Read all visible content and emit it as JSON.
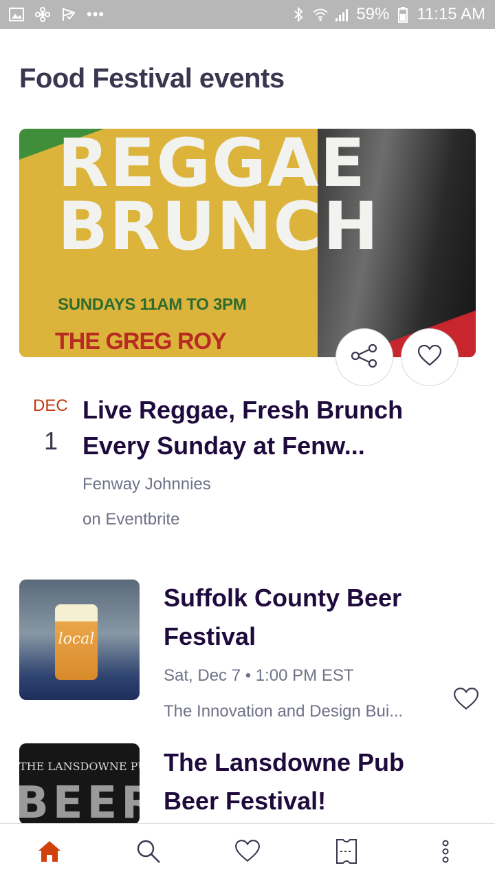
{
  "status_bar": {
    "battery": "59%",
    "time": "11:15 AM",
    "overflow": "•••"
  },
  "page": {
    "title": "Food Festival events"
  },
  "featured_event": {
    "image": {
      "title_text": "REGGAE\nBRUNCH",
      "subtitle_text": "SUNDAYS 11AM TO 3PM",
      "artist_text": "THE GREG ROY"
    },
    "date_month": "DEC",
    "date_day": "1",
    "title": "Live Reggae, Fresh Brunch Every Sunday at Fenw...",
    "venue": "Fenway Johnnies",
    "source": "on Eventbrite",
    "share_icon": "share-icon",
    "like_icon": "heart-icon"
  },
  "events": [
    {
      "title": "Suffolk County Beer Festival",
      "date": "Sat, Dec 7 • 1:00 PM EST",
      "venue": "The Innovation and Design Bui...",
      "image_text": "local",
      "like_icon": "heart-icon"
    },
    {
      "title": "The Lansdowne Pub Beer Festival!",
      "image_banner": "THE LANSDOWNE PUB",
      "image_letters": "BEER"
    }
  ],
  "bottom_nav": {
    "items": [
      {
        "icon": "home-icon",
        "active": true
      },
      {
        "icon": "search-icon",
        "active": false
      },
      {
        "icon": "heart-icon",
        "active": false
      },
      {
        "icon": "ticket-icon",
        "active": false
      },
      {
        "icon": "more-icon",
        "active": false
      }
    ]
  },
  "colors": {
    "accent": "#d1410c",
    "text_primary": "#1e0a3c",
    "text_secondary": "#6f7287",
    "status_bar": "#b7b7b7"
  }
}
